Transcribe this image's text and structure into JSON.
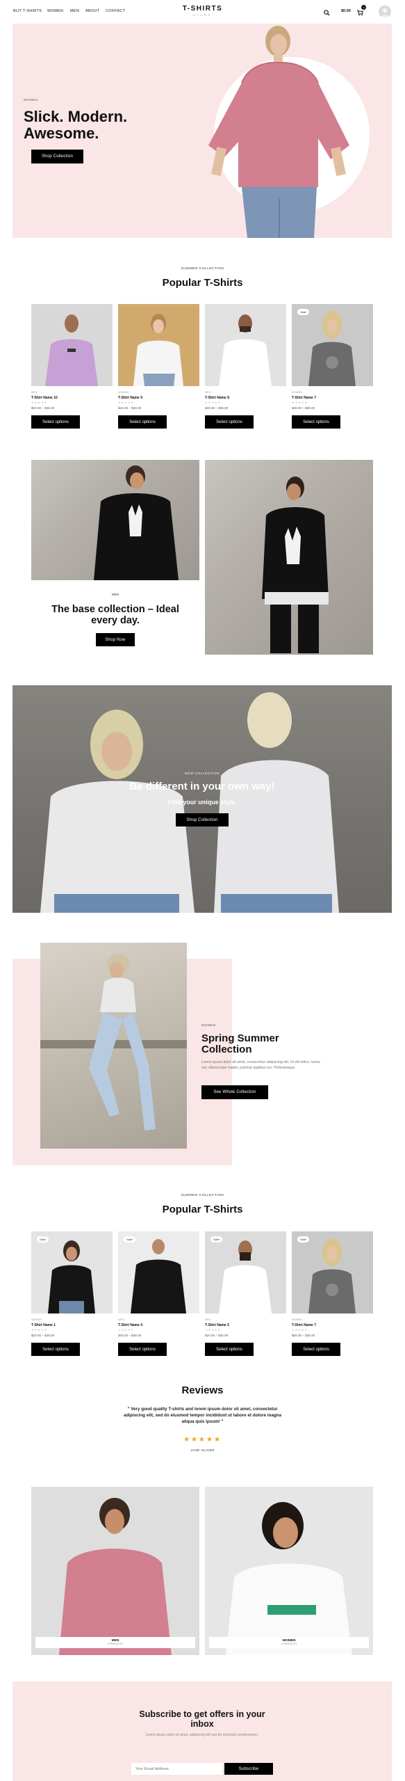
{
  "header": {
    "nav": [
      "BUY T-SHIRTS",
      "WOMEN",
      "MEN",
      "ABOUT",
      "CONTACT"
    ],
    "logo": "T-SHIRTS",
    "logo_sub": "STORE",
    "cart_total": "$0.00",
    "cart_count": "0",
    "search_icon": "search-icon",
    "cart_icon": "cart-icon",
    "avatar_icon": "user-avatar-icon"
  },
  "hero": {
    "eyebrow": "WOMEN",
    "title_line1": "Slick. Modern.",
    "title_line2": "Awesome.",
    "button": "Shop Collection"
  },
  "popular1": {
    "eyebrow": "SUMMER COLLECTION",
    "title": "Popular T-Shirts",
    "products": [
      {
        "category": "MEN",
        "name": "T-Shirt Name 10",
        "stars": "★★★★★",
        "price": "$20.00 – $35.00",
        "button": "Select options",
        "sale": ""
      },
      {
        "category": "WOMEN",
        "name": "T-Shirt Name 9",
        "stars": "★★★★★",
        "price": "$22.00 – $30.00",
        "button": "Select options",
        "sale": ""
      },
      {
        "category": "MEN",
        "name": "T-Shirt Name 8",
        "stars": "★★★★★",
        "price": "$20.00 – $35.00",
        "button": "Select options",
        "sale": ""
      },
      {
        "category": "WOMEN",
        "name": "T-Shirt Name 7",
        "stars": "★★★★★",
        "price": "$26.00 – $35.00",
        "button": "Select options",
        "sale": "Sale!"
      }
    ]
  },
  "base_collection": {
    "eyebrow": "MEN",
    "title_line1": "The base collection – Ideal",
    "title_line2": "every day.",
    "button": "Shop Now"
  },
  "banner": {
    "eyebrow": "NEW COLLECTION",
    "title": "Be different in your own way!",
    "subtitle": "Find your unique style.",
    "button": "Shop Collection"
  },
  "spring": {
    "eyebrow": "WOMEN",
    "title_line1": "Spring Summer",
    "title_line2": "Collection",
    "body": "Lorem ipsum dolor sit amet, consectetur adipiscing elit. Ut elit tellus, luctus nec ullamcorper mattis, pulvinar dapibus leo. Pellentesque.",
    "button": "See Whole Collection"
  },
  "popular2": {
    "eyebrow": "SUMMER COLLECTION",
    "title": "Popular T-Shirts",
    "products": [
      {
        "category": "WOMEN",
        "name": "T-Shirt Name 1",
        "stars": "★★★★★",
        "price": "$20.00 – $35.00",
        "button": "Select options",
        "sale": "Sale!"
      },
      {
        "category": "MEN",
        "name": "T-Shirt Name 4",
        "stars": "★★★★★",
        "price": "$20.00 – $35.00",
        "button": "Select options",
        "sale": "Sale!"
      },
      {
        "category": "MEN",
        "name": "T-Shirt Name 5",
        "stars": "★★★★★",
        "price": "$20.00 – $30.00",
        "button": "Select options",
        "sale": "Sale!"
      },
      {
        "category": "WOMEN",
        "name": "T-Shirt Name 7",
        "stars": "★★★★★",
        "price": "$26.00 – $35.00",
        "button": "Select options",
        "sale": "Sale!"
      }
    ]
  },
  "reviews": {
    "title": "Reviews",
    "quote": "\" Very good quality T-shirts and lorem ipsum dolor sit amet, consectetur adipiscing elit, sed do eiusmod tempor incididunt ut labore et dolore magna aliqua quis ipsum! \"",
    "stars": "★★★★★",
    "author": "JANE OLIVER"
  },
  "categories": [
    {
      "title": "MEN",
      "sub": "2 PRODUCTS"
    },
    {
      "title": "WOMEN",
      "sub": "3 PRODUCTS"
    }
  ],
  "subscribe": {
    "title_line1": "Subscribe to get offers in your",
    "title_line2": "inbox",
    "body": "Lorem ipsum dolor sit amet, adipiscing elit sed do eiusmod condimentum.",
    "placeholder": "Your Email Address",
    "button": "Subscribe"
  },
  "colors": {
    "accent_pink": "#fae6e6",
    "button": "#000000",
    "star_gold": "#f2a316"
  }
}
